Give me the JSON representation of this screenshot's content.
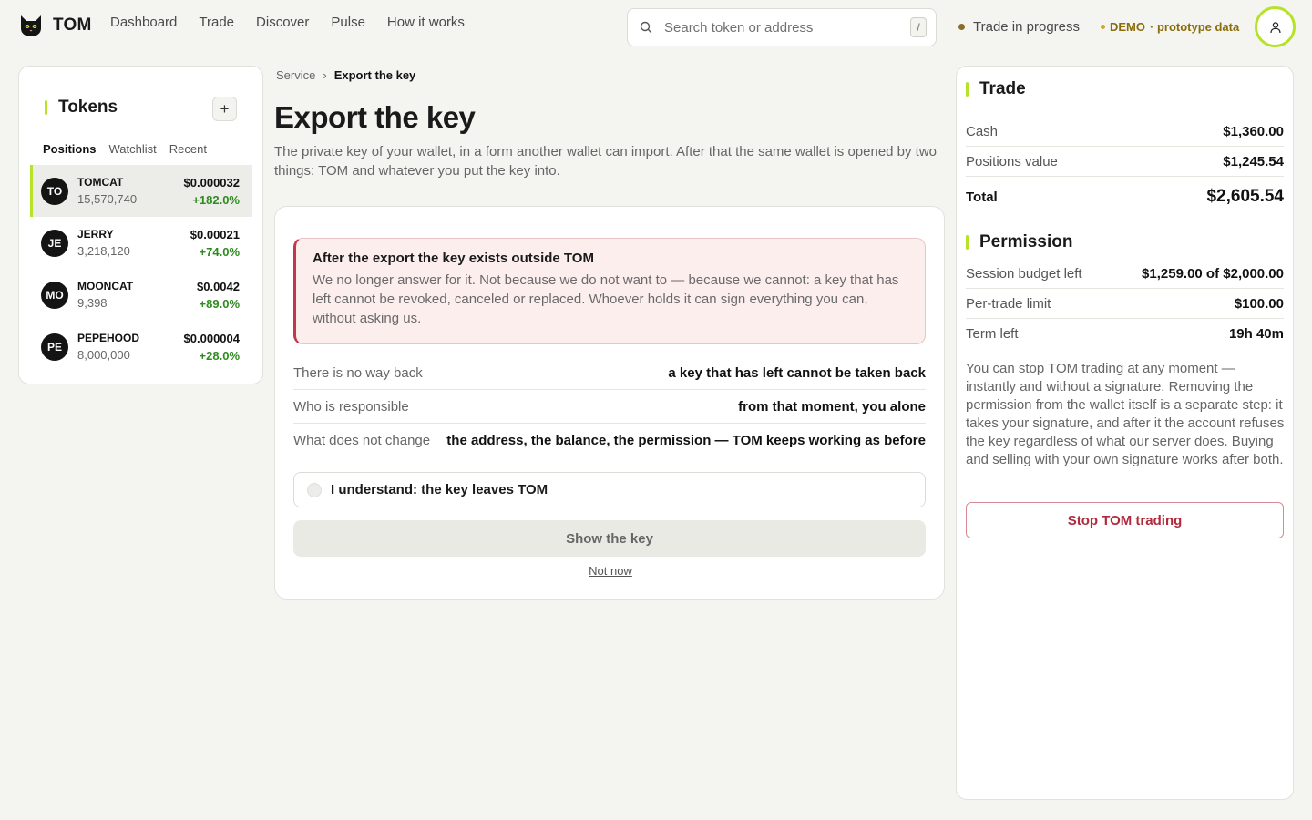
{
  "app": {
    "name": "TOM"
  },
  "nav": [
    "Dashboard",
    "Trade",
    "Discover",
    "Pulse",
    "How it works"
  ],
  "search": {
    "placeholder": "Search token or address",
    "shortcut": "/"
  },
  "status": {
    "text": "Trade in progress"
  },
  "demo": {
    "label": "DEMO",
    "sub": "· prototype data"
  },
  "tokens_panel": {
    "title": "Tokens",
    "add_label": "+",
    "tabs": [
      "Positions",
      "Watchlist",
      "Recent"
    ],
    "active_tab": "Positions",
    "items": [
      {
        "initials": "TO",
        "symbol": "TOMCAT",
        "qty": "15,570,740",
        "price": "$0.000032",
        "change": "+182.0%"
      },
      {
        "initials": "JE",
        "symbol": "JERRY",
        "qty": "3,218,120",
        "price": "$0.00021",
        "change": "+74.0%"
      },
      {
        "initials": "MO",
        "symbol": "MOONCAT",
        "qty": "9,398",
        "price": "$0.0042",
        "change": "+89.0%"
      },
      {
        "initials": "PE",
        "symbol": "PEPEHOOD",
        "qty": "8,000,000",
        "price": "$0.000004",
        "change": "+28.0%"
      }
    ]
  },
  "breadcrumb": {
    "parent": "Service",
    "sep": "›",
    "current": "Export the key"
  },
  "page": {
    "title": "Export the key",
    "description": "The private key of your wallet, in a form another wallet can import. After that the same wallet is opened by two things: TOM and whatever you put the key into."
  },
  "warning": {
    "title": "After the export the key exists outside TOM",
    "body": "We no longer answer for it. Not because we do not want to — because we cannot: a key that has left cannot be revoked, canceled or replaced. Whoever holds it can sign everything you can, without asking us."
  },
  "facts": [
    {
      "label": "There is no way back",
      "value": "a key that has left cannot be taken back"
    },
    {
      "label": "Who is responsible",
      "value": "from that moment, you alone"
    },
    {
      "label": "What does not change",
      "value": "the address, the balance, the permission — TOM keeps working as before"
    }
  ],
  "confirm": {
    "label": "I understand: the key leaves TOM",
    "checked": false
  },
  "actions": {
    "show_key": "Show the key",
    "not_now": "Not now"
  },
  "trade": {
    "title": "Trade",
    "cash_label": "Cash",
    "cash": "$1,360.00",
    "positions_label": "Positions value",
    "positions": "$1,245.54",
    "total_label": "Total",
    "total": "$2,605.54"
  },
  "permission": {
    "title": "Permission",
    "budget_label": "Session budget left",
    "budget": "$1,259.00 of $2,000.00",
    "limit_label": "Per-trade limit",
    "limit": "$100.00",
    "term_label": "Term left",
    "term": "19h 40m",
    "note": "You can stop TOM trading at any moment — instantly and without a signature. Removing the permission from the wallet itself is a separate step: it takes your signature, and after it the account refuses the key regardless of what our server does. Buying and selling with your own signature works after both.",
    "stop_label": "Stop TOM trading"
  },
  "colors": {
    "accent": "#b7e22a",
    "positive": "#2e8b1f",
    "danger": "#c0394a",
    "demo": "#8a6d0a"
  },
  "icons": {
    "logo": "cat-logo-icon",
    "search": "search-icon",
    "user": "user-icon"
  }
}
